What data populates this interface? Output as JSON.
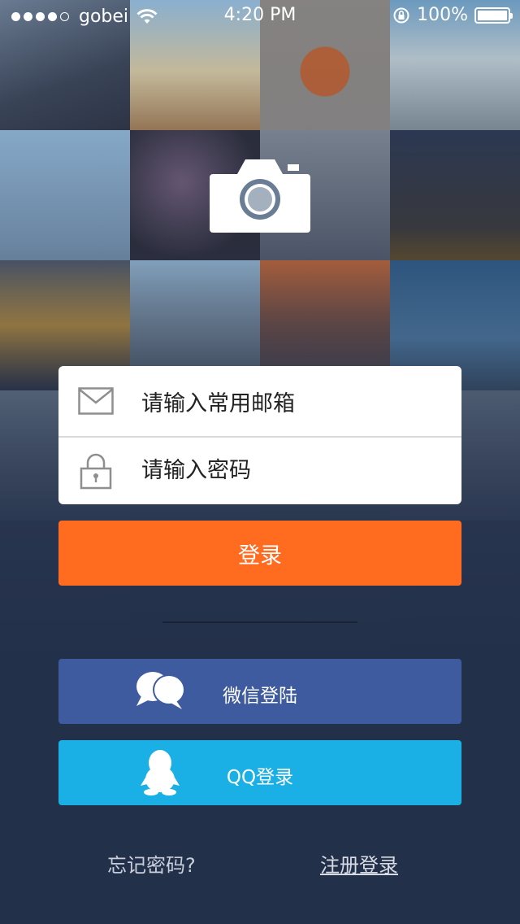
{
  "status_bar": {
    "carrier": "gobei",
    "time": "4:20 PM",
    "battery": "100%"
  },
  "icons": {
    "camera": "camera-icon",
    "email": "mail-icon",
    "password": "lock-icon",
    "wechat": "wechat-bubbles-icon",
    "qq": "qq-penguin-icon"
  },
  "login_form": {
    "email_placeholder": "请输入常用邮箱",
    "password_placeholder": "请输入密码",
    "login_button": "登录"
  },
  "social": {
    "wechat_label": "微信登陆",
    "qq_label": "QQ登录"
  },
  "footer": {
    "forgot_password": "忘记密码?",
    "register": "注册登录"
  },
  "colors": {
    "accent": "#ff6b1f",
    "wechat": "#3d5b9e",
    "qq": "#1ab0e6",
    "background": "#23304a"
  }
}
